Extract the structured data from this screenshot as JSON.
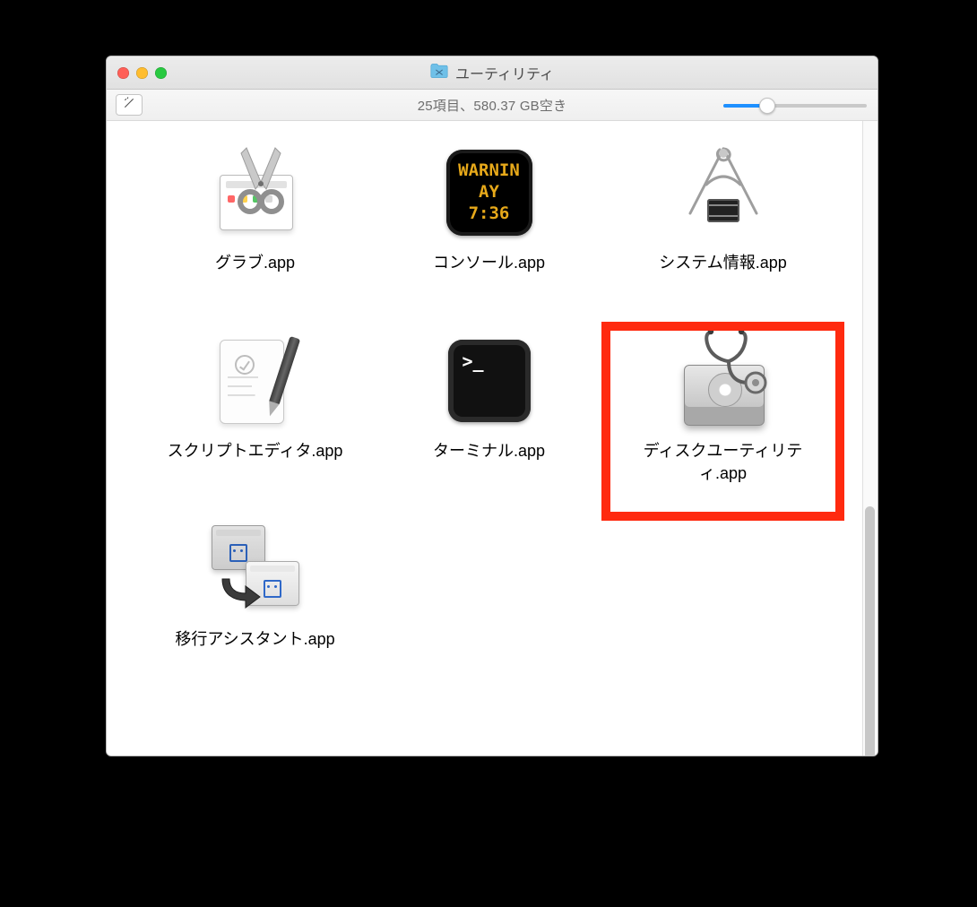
{
  "window": {
    "title": "ユーティリティ",
    "folder_icon": "utilities-folder-icon"
  },
  "status": {
    "text": "25項目、580.37 GB空き"
  },
  "toolbar": {
    "action_icon": "wand-icon",
    "icon_size_slider": {
      "value": 30,
      "min": 0,
      "max": 100
    }
  },
  "items": [
    {
      "label": "グラブ.app",
      "icon": "grab-icon",
      "highlighted": false
    },
    {
      "label": "コンソール.app",
      "icon": "console-icon",
      "highlighted": false,
      "screen_lines": [
        "WARNIN",
        "AY 7:36"
      ]
    },
    {
      "label": "システム情報.app",
      "icon": "system-info-icon",
      "highlighted": false
    },
    {
      "label": "スクリプトエディタ.app",
      "icon": "script-editor-icon",
      "highlighted": false
    },
    {
      "label": "ターミナル.app",
      "icon": "terminal-icon",
      "highlighted": false,
      "prompt": ">_"
    },
    {
      "label": "ディスクユーティリティ.app",
      "icon": "disk-utility-icon",
      "highlighted": true
    },
    {
      "label": "移行アシスタント.app",
      "icon": "migration-assistant-icon",
      "highlighted": false
    }
  ]
}
